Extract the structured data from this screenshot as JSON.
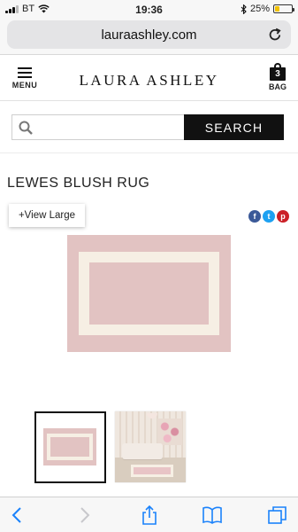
{
  "status_bar": {
    "carrier": "BT",
    "time": "19:36",
    "battery_percent": "25%",
    "battery_level": 0.25,
    "battery_color": "#f2c200",
    "icons": [
      "signal-icon",
      "wifi-icon",
      "bluetooth-icon",
      "battery-icon"
    ]
  },
  "browser": {
    "url": "lauraashley.com",
    "reload_icon": "reload-icon",
    "toolbar_icons": [
      "back-icon",
      "forward-icon",
      "share-icon",
      "bookmarks-icon",
      "tabs-icon"
    ]
  },
  "header": {
    "menu_label": "MENU",
    "brand": "LAURA ASHLEY",
    "bag_count": "3",
    "bag_label": "BAG"
  },
  "search": {
    "placeholder": "",
    "value": "",
    "button_label": "SEARCH"
  },
  "product": {
    "title": "LEWES BLUSH RUG",
    "view_large_label": "+View Large",
    "share": [
      {
        "name": "facebook-icon",
        "glyph": "f",
        "color": "#3b5998"
      },
      {
        "name": "twitter-icon",
        "glyph": "t",
        "color": "#1da1f2"
      },
      {
        "name": "pinterest-icon",
        "glyph": "p",
        "color": "#cb2027"
      }
    ],
    "rug_color": "#e2c3c2",
    "border_color": "#f6efe4"
  },
  "colors": {
    "accent": "#111111",
    "ios_blue": "#1a82fb"
  }
}
